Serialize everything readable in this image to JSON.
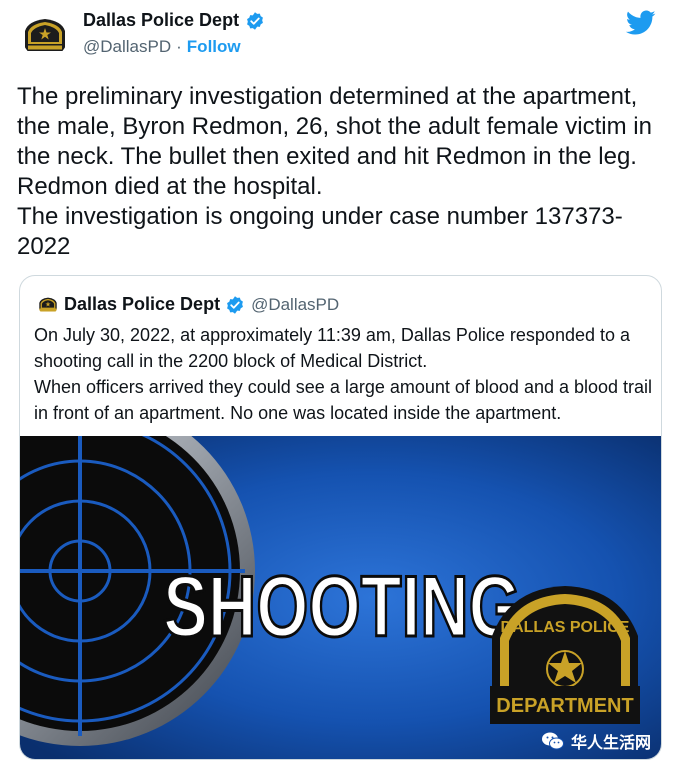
{
  "account": {
    "name": "Dallas Police Dept",
    "handle": "@DallasPD",
    "separator": "·",
    "follow_label": "Follow"
  },
  "tweet": {
    "text": "The preliminary investigation determined at the apartment, the male, Byron Redmon, 26, shot the adult female victim in the neck. The bullet then exited and hit Redmon in the leg. Redmon died at the hospital.\nThe investigation is ongoing under case number 137373-2022"
  },
  "quoted": {
    "name": "Dallas Police Dept",
    "handle": "@DallasPD",
    "text": "On July 30, 2022, at approximately 11:39 am, Dallas Police responded to a shooting call in the 2200 block of Medical District.\nWhen officers arrived they could see a large amount of blood and a blood trail in front of an apartment. No one was located inside the apartment."
  },
  "media": {
    "headline": "SHOOTING",
    "badge_top": "DALLAS POLICE",
    "badge_bottom": "DEPARTMENT"
  },
  "watermark": {
    "text": "华人生活网"
  },
  "icons": {
    "verified": "verified-badge-icon",
    "twitter": "twitter-bird-icon",
    "watermark": "wechat-icon"
  },
  "colors": {
    "accent": "#1d9bf0",
    "text": "#0f1419",
    "secondary": "#536471",
    "border": "#cfd9de",
    "media_blue": "#1a5bbf"
  }
}
